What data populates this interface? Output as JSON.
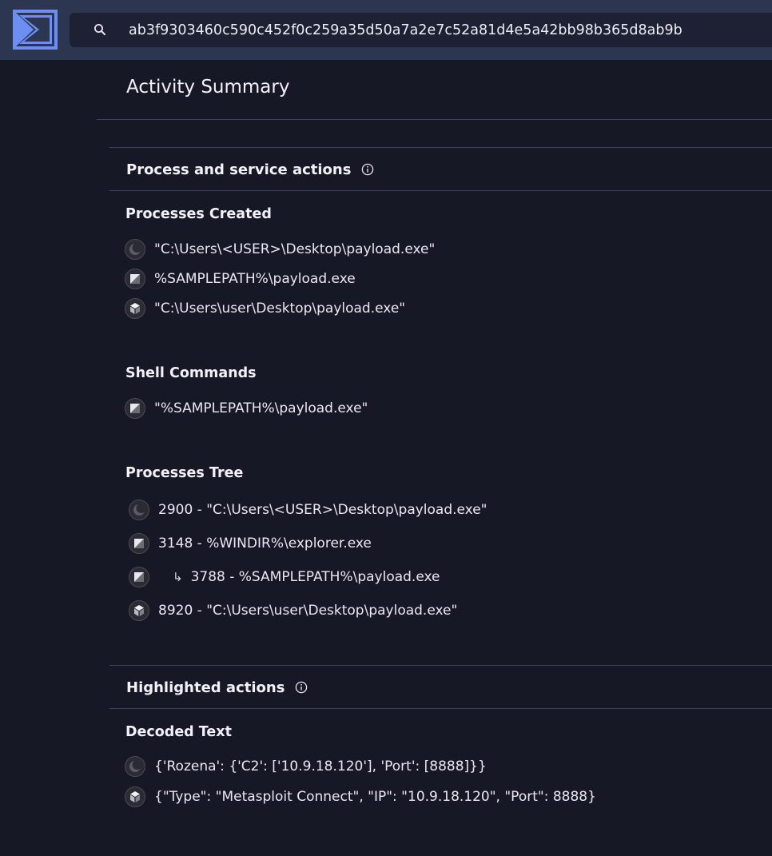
{
  "topbar": {
    "logo_icon": "sigma-logo-icon",
    "search": {
      "icon": "search-icon",
      "value": "ab3f9303460c590c452f0c259a35d50a7a2e7c52a81d4e5a42bb98b365d8ab9b"
    }
  },
  "page": {
    "title": "Activity Summary"
  },
  "sections": {
    "process_actions": {
      "title": "Process and service actions",
      "processes_created": {
        "title": "Processes Created",
        "items": [
          {
            "icon": "sandbox-crescent-icon",
            "text": "\"C:\\Users\\<USER>\\Desktop\\payload.exe\""
          },
          {
            "icon": "sandbox-diagonal-icon",
            "text": "%SAMPLEPATH%\\payload.exe"
          },
          {
            "icon": "sandbox-cube-icon",
            "text": "\"C:\\Users\\user\\Desktop\\payload.exe\""
          }
        ]
      },
      "shell_commands": {
        "title": "Shell Commands",
        "items": [
          {
            "icon": "sandbox-diagonal-icon",
            "text": "\"%SAMPLEPATH%\\payload.exe\""
          }
        ]
      },
      "processes_tree": {
        "title": "Processes Tree",
        "items": [
          {
            "icon": "sandbox-crescent-icon",
            "text": "2900 - \"C:\\Users\\<USER>\\Desktop\\payload.exe\"",
            "child": false
          },
          {
            "icon": "sandbox-diagonal-icon",
            "text": "3148 - %WINDIR%\\explorer.exe",
            "child": false
          },
          {
            "icon": "sandbox-diagonal-icon",
            "text": "3788 - %SAMPLEPATH%\\payload.exe",
            "child": true,
            "arrow": "↳"
          },
          {
            "icon": "sandbox-cube-icon",
            "text": "8920 - \"C:\\Users\\user\\Desktop\\payload.exe\"",
            "child": false
          }
        ]
      }
    },
    "highlighted_actions": {
      "title": "Highlighted actions",
      "decoded_text": {
        "title": "Decoded Text",
        "items": [
          {
            "icon": "sandbox-crescent-icon",
            "text": "{'Rozena': {'C2': ['10.9.18.120'], 'Port': [8888]}}"
          },
          {
            "icon": "sandbox-cube-icon",
            "text": "{\"Type\": \"Metasploit Connect\", \"IP\": \"10.9.18.120\", \"Port\": 8888}"
          }
        ]
      }
    }
  },
  "colors": {
    "background": "#171826",
    "topbar": "#2c3650",
    "search_bg": "#1d2133",
    "logo_accent": "#6d8ff2",
    "divider": "#3d4257"
  }
}
